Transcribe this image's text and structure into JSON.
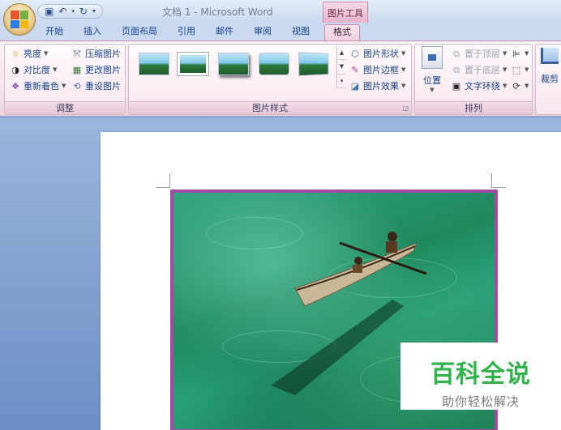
{
  "window": {
    "title": "文档 1 - Microsoft Word",
    "context_tab_title": "图片工具"
  },
  "tabs": [
    {
      "label": "开始",
      "active": false
    },
    {
      "label": "插入",
      "active": false
    },
    {
      "label": "页面布局",
      "active": false
    },
    {
      "label": "引用",
      "active": false
    },
    {
      "label": "邮件",
      "active": false
    },
    {
      "label": "审阅",
      "active": false
    },
    {
      "label": "视图",
      "active": false
    },
    {
      "label": "格式",
      "active": true
    }
  ],
  "ribbon": {
    "adjust": {
      "label": "调整",
      "items": {
        "brightness": "亮度",
        "contrast": "对比度",
        "recolor": "重新着色",
        "compress": "压缩图片",
        "change": "更改图片",
        "reset": "重设图片"
      }
    },
    "styles": {
      "label": "图片样式",
      "shape": "图片形状",
      "border": "图片边框",
      "effects": "图片效果"
    },
    "arrange": {
      "label": "排列",
      "position": "位置",
      "bring_front": "置于顶层",
      "send_back": "置于底层",
      "text_wrap": "文字环绕"
    },
    "size": {
      "crop": "裁剪"
    }
  },
  "watermark": {
    "main": "百科全说",
    "sub": "助你轻松解决"
  },
  "colors": {
    "picture_border": "#a24aa6",
    "watermark_green": "#2fb34a",
    "context_tab": "#e8b4cc"
  }
}
